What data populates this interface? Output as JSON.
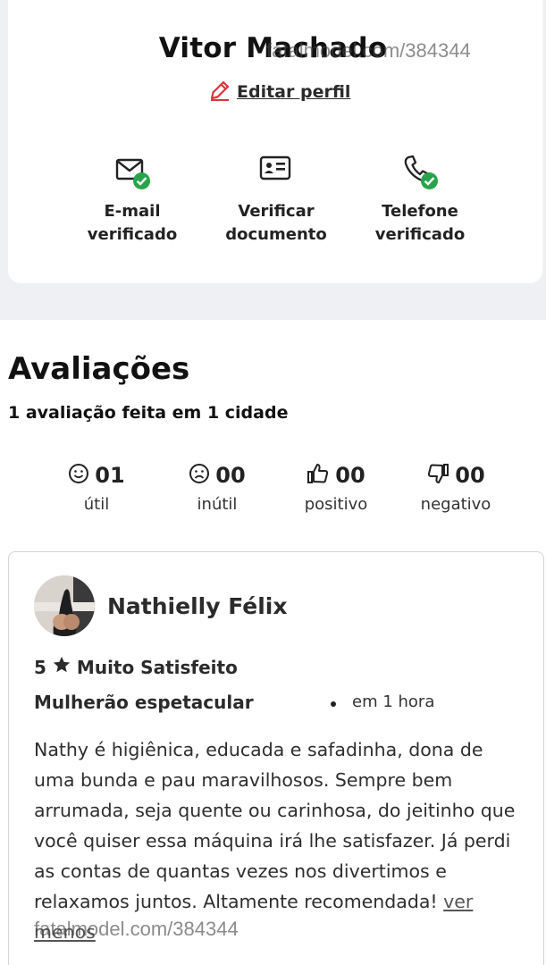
{
  "profile": {
    "name": "Vitor Machado",
    "edit_label": "Editar perfil",
    "watermark": "fatalmodel.com/384344"
  },
  "verifications": [
    {
      "line1": "E-mail",
      "line2": "verificado",
      "icon": "mail-icon",
      "verified": true
    },
    {
      "line1": "Verificar",
      "line2": "documento",
      "icon": "id-card-icon",
      "verified": false
    },
    {
      "line1": "Telefone",
      "line2": "verificado",
      "icon": "phone-icon",
      "verified": true
    }
  ],
  "reviews_section": {
    "title": "Avaliações",
    "subtitle": "1 avaliação feita em 1 cidade",
    "stats": [
      {
        "value": "01",
        "label": "útil",
        "icon": "smile-icon"
      },
      {
        "value": "00",
        "label": "inútil",
        "icon": "frown-icon"
      },
      {
        "value": "00",
        "label": "positivo",
        "icon": "thumbs-up-icon"
      },
      {
        "value": "00",
        "label": "negativo",
        "icon": "thumbs-down-icon"
      }
    ]
  },
  "review": {
    "reviewer_name": "Nathielly Félix",
    "rating": "5",
    "rating_text": "Muito Satisfeito",
    "title": "Mulherão espetacular",
    "time": "em 1 hora",
    "body": "Nathy é higiênica, educada e safadinha, dona de uma bunda e pau maravilhosos. Sempre bem arrumada, seja quente ou carinhosa, do jeitinho que você quiser essa máquina irá lhe satisfazer. Já perdi as contas de quantas vezes nos divertimos e relaxamos juntos. Altamente recomendada!",
    "see_less": "ver menos"
  },
  "colors": {
    "verified_green": "#29a34a",
    "edit_red": "#d9343a",
    "background_gray": "#eef0f4"
  }
}
